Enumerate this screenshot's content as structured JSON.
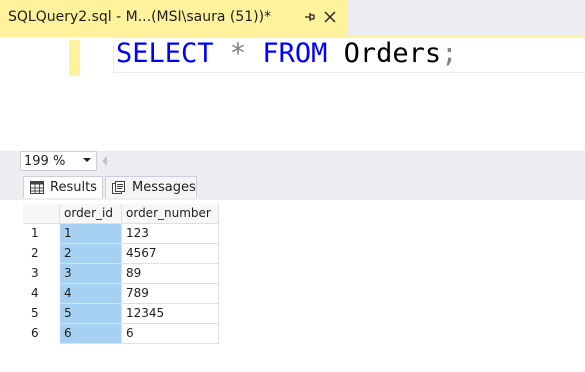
{
  "tab": {
    "title": "SQLQuery2.sql - M...(MSI\\saura (51))*",
    "pin_icon": "pin-icon",
    "close_icon": "close-icon",
    "accent": "#fff29d"
  },
  "editor": {
    "tokens": [
      {
        "text": "SELECT",
        "kind": "keyword"
      },
      {
        "text": " ",
        "kind": "space"
      },
      {
        "text": "*",
        "kind": "operator"
      },
      {
        "text": " ",
        "kind": "space"
      },
      {
        "text": "FROM",
        "kind": "keyword"
      },
      {
        "text": " ",
        "kind": "space"
      },
      {
        "text": "Orders",
        "kind": "identifier"
      },
      {
        "text": ";",
        "kind": "operator"
      }
    ],
    "colors": {
      "keyword": "#0000ff",
      "operator": "#808080",
      "identifier": "#000000"
    }
  },
  "zoom": {
    "value": "199 %"
  },
  "results_tabs": [
    {
      "label": "Results",
      "icon": "grid-icon",
      "active": true
    },
    {
      "label": "Messages",
      "icon": "messages-icon",
      "active": false
    }
  ],
  "grid": {
    "columns": [
      "order_id",
      "order_number"
    ],
    "rows": [
      {
        "num": "1",
        "order_id": "1",
        "order_number": "123"
      },
      {
        "num": "2",
        "order_id": "2",
        "order_number": "4567"
      },
      {
        "num": "3",
        "order_id": "3",
        "order_number": "89"
      },
      {
        "num": "4",
        "order_id": "4",
        "order_number": "789"
      },
      {
        "num": "5",
        "order_id": "5",
        "order_number": "12345"
      },
      {
        "num": "6",
        "order_id": "6",
        "order_number": "6"
      }
    ],
    "selected_column": "order_id",
    "selection_color": "#a7d1f2"
  }
}
